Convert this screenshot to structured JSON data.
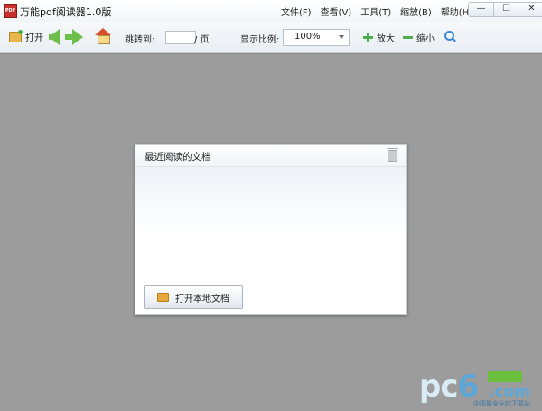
{
  "window": {
    "title": "万能pdf阅读器1.0版",
    "app_icon_text": "PDF",
    "menu": [
      "文件(F)",
      "查看(V)",
      "工具(T)",
      "缩放(B)",
      "帮助(H)"
    ],
    "controls": {
      "minimize": "—",
      "maximize": "☐",
      "close": "✕"
    }
  },
  "toolbar": {
    "open_label": "打开",
    "jump_label": "跳转到:",
    "page_value": "",
    "page_suffix": "/ 页",
    "zoom_label": "显示比例:",
    "zoom_value": "100%",
    "zoom_in_label": "放大",
    "zoom_out_label": "缩小"
  },
  "recent_panel": {
    "title": "最近阅读的文档",
    "open_local_label": "打开本地文档"
  },
  "watermark": {
    "brand_pc": "pc",
    "brand_six": "6",
    "brand_com": ".com",
    "tagline": "中国最安全的下载站"
  },
  "colors": {
    "workspace": "#9c9c9c",
    "accent_green": "#4caf50",
    "accent_blue": "#3a86d0"
  }
}
